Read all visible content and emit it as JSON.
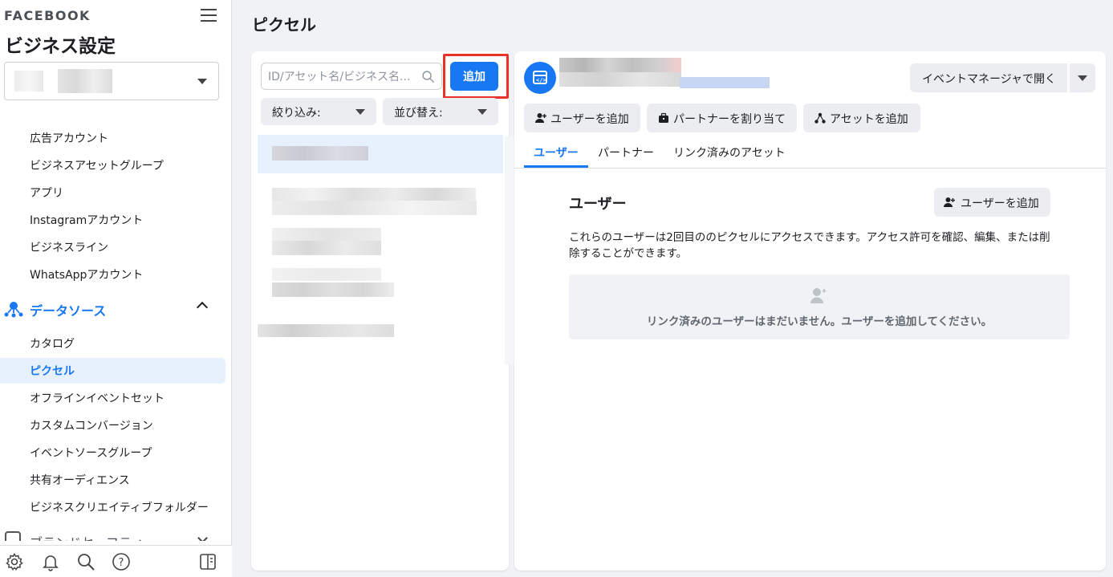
{
  "sidebar": {
    "brand": "FACEBOOK",
    "title": "ビジネス設定",
    "nav_items": [
      "広告アカウント",
      "ビジネスアセットグループ",
      "アプリ",
      "Instagramアカウント",
      "ビジネスライン",
      "WhatsAppアカウント"
    ],
    "section_label": "データソース",
    "section_items": [
      "カタログ",
      "ピクセル",
      "オフラインイベントセット",
      "カスタムコンバージョン",
      "イベントソースグループ",
      "共有オーディエンス",
      "ビジネスクリエイティブフォルダー"
    ],
    "active_item": "ピクセル",
    "next_section_label": "ブランドセーフティ"
  },
  "page_title": "ピクセル",
  "list_panel": {
    "search_placeholder": "ID/アセット名/ビジネス名...",
    "add_button": "追加",
    "filter_label": "絞り込み:",
    "sort_label": "並び替え:"
  },
  "detail": {
    "open_event_manager": "イベントマネージャで開く",
    "actions": [
      "ユーザーを追加",
      "パートナーを割り当て",
      "アセットを追加"
    ],
    "tabs": [
      "ユーザー",
      "パートナー",
      "リンク済みのアセット"
    ],
    "active_tab": "ユーザー",
    "section_title": "ユーザー",
    "section_add_button": "ユーザーを追加",
    "section_desc": "これらのユーザーは2回目ののピクセルにアクセスできます。アクセス許可を確認、編集、または削除することができます。",
    "empty_text": "リンク済みのユーザーはまだいません。ユーザーを追加してください。"
  },
  "colors": {
    "accent": "#1877f2",
    "highlight": "#e8332a",
    "surface": "#ffffff",
    "background": "#f0f2f5"
  }
}
